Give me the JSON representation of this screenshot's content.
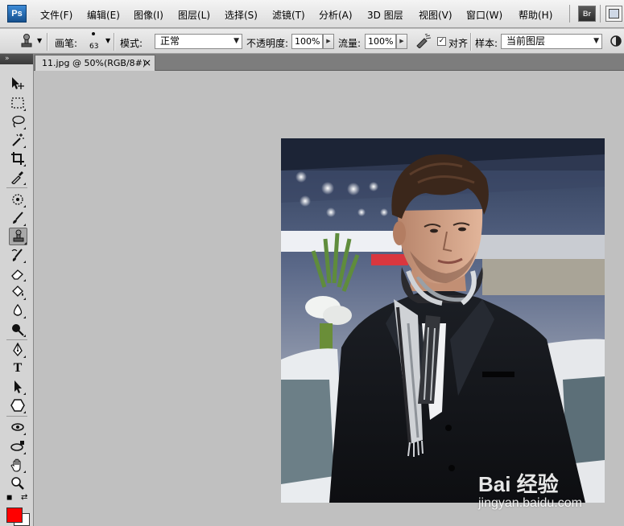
{
  "app": {
    "logo_text": "Ps",
    "bridge_label": "Br",
    "colors": {
      "accent": "#1f5fa8",
      "foreground_color": "#ff0000",
      "background_color": "#ffffff"
    }
  },
  "menu": {
    "items": [
      {
        "label": "文件(F)"
      },
      {
        "label": "编辑(E)"
      },
      {
        "label": "图像(I)"
      },
      {
        "label": "图层(L)"
      },
      {
        "label": "选择(S)"
      },
      {
        "label": "滤镜(T)"
      },
      {
        "label": "分析(A)"
      },
      {
        "label": "3D 图层"
      },
      {
        "label": "视图(V)"
      },
      {
        "label": "窗口(W)"
      },
      {
        "label": "帮助(H)"
      }
    ]
  },
  "options": {
    "brush_label": "画笔:",
    "brush_size": "63",
    "mode_label": "模式:",
    "mode_value": "正常",
    "opacity_label": "不透明度:",
    "opacity_value": "100%",
    "flow_label": "流量:",
    "flow_value": "100%",
    "aligned_label": "对齐",
    "aligned_checked": "✓",
    "sample_label": "样本:",
    "sample_value": "当前图层"
  },
  "document": {
    "tab_title": "11.jpg @ 50%(RGB/8#)",
    "close_glyph": "×"
  },
  "toolbox": {
    "header_glyph": "»",
    "tools": [
      {
        "name": "move-tool-icon"
      },
      {
        "name": "marquee-tool-icon"
      },
      {
        "name": "lasso-tool-icon"
      },
      {
        "name": "magic-wand-tool-icon"
      },
      {
        "name": "crop-tool-icon"
      },
      {
        "name": "eyedropper-tool-icon"
      },
      {
        "name": "spot-healing-tool-icon"
      },
      {
        "name": "brush-tool-icon"
      },
      {
        "name": "clone-stamp-tool-icon"
      },
      {
        "name": "history-brush-tool-icon"
      },
      {
        "name": "eraser-tool-icon"
      },
      {
        "name": "paint-bucket-tool-icon"
      },
      {
        "name": "blur-tool-icon"
      },
      {
        "name": "dodge-tool-icon"
      },
      {
        "name": "pen-tool-icon"
      },
      {
        "name": "type-tool-icon"
      },
      {
        "name": "path-selection-tool-icon"
      },
      {
        "name": "shape-tool-icon"
      },
      {
        "name": "3d-rotate-tool-icon"
      },
      {
        "name": "3d-orbit-tool-icon"
      },
      {
        "name": "hand-tool-icon"
      },
      {
        "name": "zoom-tool-icon"
      }
    ],
    "type_tool_glyph": "T"
  },
  "watermark": {
    "logo": "Bai 经验",
    "url": "jingyan.baidu.com"
  }
}
